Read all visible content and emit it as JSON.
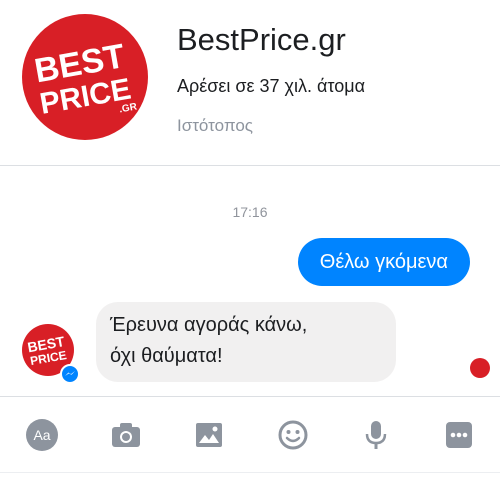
{
  "page": {
    "name": "BestPrice.gr",
    "likes": "Αρέσει σε 37 χιλ. άτομα",
    "category": "Ιστότοπος",
    "logo_text_top": "BEST",
    "logo_text_bottom": "PRICE",
    "logo_suffix": ".GR"
  },
  "thread": {
    "timestamp": "17:16",
    "outgoing_message": "Θέλω γκόμενα",
    "incoming_message_line1": "Έρευνα αγοράς κάνω,",
    "incoming_message_line2": "όχι θαύματα!"
  },
  "composer": {
    "tools": [
      "text-format-icon",
      "camera-icon",
      "gallery-icon",
      "emoji-icon",
      "microphone-icon",
      "more-icon"
    ],
    "text_format_label": "Aa"
  },
  "colors": {
    "brand_red": "#d81f26",
    "messenger_blue": "#0084ff",
    "incoming_bubble": "#f1f0f0",
    "icon_gray": "#8d949e"
  }
}
